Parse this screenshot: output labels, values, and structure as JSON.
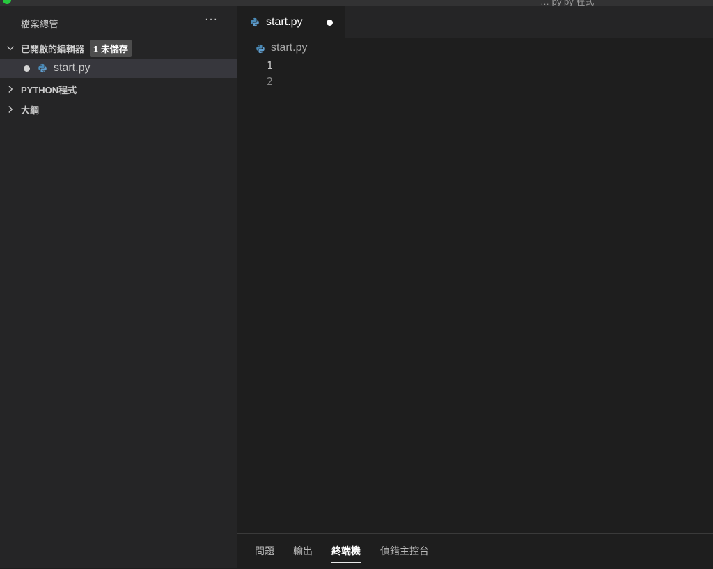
{
  "window": {
    "title": "…  py  py  程式",
    "colors": {
      "traffic_light": "#27c93f"
    }
  },
  "sidebar": {
    "title": "檔案總管",
    "more_icon": "ellipsis-icon",
    "more_label": "···",
    "sections": [
      {
        "label": "已開啟的編輯器",
        "expanded": true,
        "badge": "1 未儲存"
      },
      {
        "label": "PYTHON程式",
        "expanded": false
      },
      {
        "label": "大綱",
        "expanded": false
      }
    ],
    "open_editors": [
      {
        "name": "start.py",
        "modified": true,
        "icon": "python-icon"
      }
    ]
  },
  "editor": {
    "tabs": [
      {
        "label": "start.py",
        "dirty": true,
        "icon": "python-icon"
      }
    ],
    "breadcrumb": {
      "file": "start.py",
      "icon": "python-icon"
    },
    "line_numbers": [
      "1",
      "2"
    ],
    "content": [
      "",
      ""
    ]
  },
  "panel": {
    "tabs": [
      {
        "label": "問題",
        "active": false
      },
      {
        "label": "輸出",
        "active": false
      },
      {
        "label": "終端機",
        "active": true
      },
      {
        "label": "偵錯主控台",
        "active": false
      }
    ]
  }
}
